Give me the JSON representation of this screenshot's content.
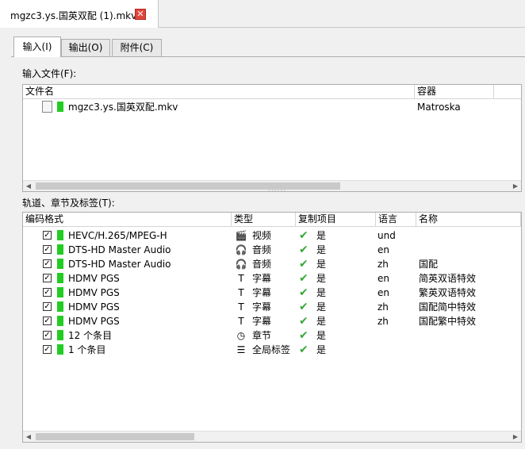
{
  "document_tab": {
    "title": "mgzc3.ys.国英双配 (1).mkv",
    "close_glyph": "✕"
  },
  "tabs": [
    {
      "label": "输入(I)",
      "active": true
    },
    {
      "label": "输出(O)",
      "active": false
    },
    {
      "label": "附件(C)",
      "active": false
    }
  ],
  "input_files": {
    "label": "输入文件(F):",
    "columns": {
      "name": "文件名",
      "container": "容器"
    },
    "files": [
      {
        "name": "mgzc3.ys.国英双配.mkv",
        "container": "Matroska"
      }
    ]
  },
  "tracks": {
    "label": "轨道、章节及标签(T):",
    "columns": {
      "codec": "编码格式",
      "type": "类型",
      "copy": "复制项目",
      "lang": "语言",
      "name": "名称"
    },
    "rows": [
      {
        "codec": "HEVC/H.265/MPEG-H",
        "type_icon": "video-icon",
        "type": "视频",
        "copy": "是",
        "lang": "und",
        "name": ""
      },
      {
        "codec": "DTS-HD Master Audio",
        "type_icon": "headphones-icon",
        "type": "音频",
        "copy": "是",
        "lang": "en",
        "name": ""
      },
      {
        "codec": "DTS-HD Master Audio",
        "type_icon": "headphones-icon",
        "type": "音频",
        "copy": "是",
        "lang": "zh",
        "name": "国配"
      },
      {
        "codec": "HDMV PGS",
        "type_icon": "text-icon",
        "type": "字幕",
        "copy": "是",
        "lang": "en",
        "name": "简英双语特效"
      },
      {
        "codec": "HDMV PGS",
        "type_icon": "text-icon",
        "type": "字幕",
        "copy": "是",
        "lang": "en",
        "name": "繁英双语特效"
      },
      {
        "codec": "HDMV PGS",
        "type_icon": "text-icon",
        "type": "字幕",
        "copy": "是",
        "lang": "zh",
        "name": "国配简中特效"
      },
      {
        "codec": "HDMV PGS",
        "type_icon": "text-icon",
        "type": "字幕",
        "copy": "是",
        "lang": "zh",
        "name": "国配繁中特效"
      },
      {
        "codec": "12 个条目",
        "type_icon": "clock-icon",
        "type": "章节",
        "copy": "是",
        "lang": "",
        "name": ""
      },
      {
        "codec": "1 个条目",
        "type_icon": "tags-icon",
        "type": "全局标签",
        "copy": "是",
        "lang": "",
        "name": ""
      }
    ]
  },
  "colors": {
    "track_marker": "#22cc22",
    "check_green": "#3aa83a",
    "close_red": "#e0443b"
  }
}
